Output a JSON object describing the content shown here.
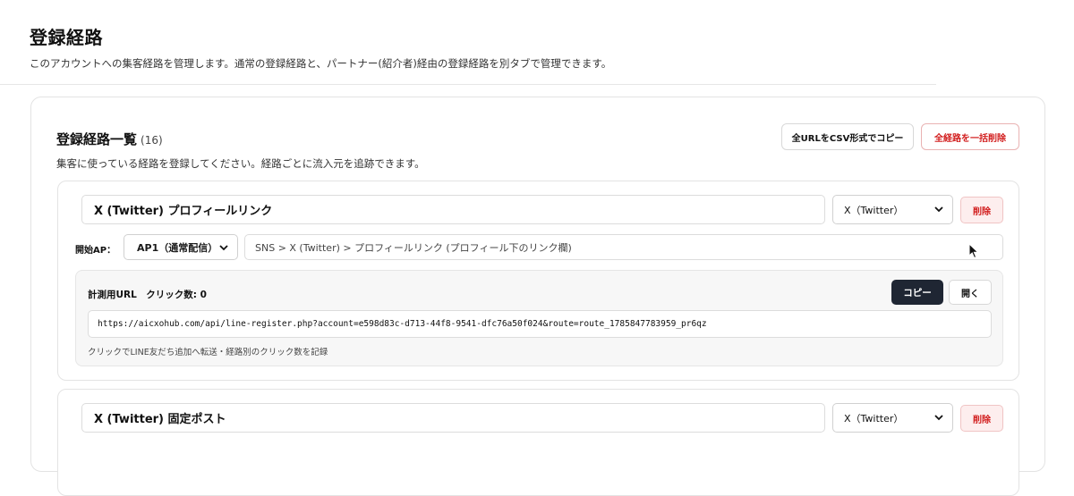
{
  "page": {
    "title": "登録経路",
    "description": "このアカウントへの集客経路を管理します。通常の登録経路と、パートナー(紹介者)経由の登録経路を別タブで管理できます。"
  },
  "section": {
    "title": "登録経路一覧",
    "count": "(16)",
    "description": "集客に使っている経路を登録してください。経路ごとに流入元を追跡できます。",
    "copy_all_label": "全URLをCSV形式でコピー",
    "delete_all_label": "全経路を一括削除"
  },
  "routes": [
    {
      "name": "X (Twitter) プロフィールリンク",
      "type": "X（Twitter）",
      "delete_label": "削除",
      "start_label": "開始AP：",
      "start_ap": "AP1（通常配信）",
      "path_placeholder": "SNS > X (Twitter) > プロフィールリンク (プロフィール下のリンク欄)",
      "tracking_label": "計測用URL　クリック数: 0",
      "copy_label": "コピー",
      "open_label": "開く",
      "url": "https://aicxohub.com/api/line-register.php?account=e598d83c-d713-44f8-9541-dfc76a50f024&route=route_1785847783959_pr6qz",
      "note": "クリックでLINE友だち追加へ転送・経路別のクリック数を記録"
    },
    {
      "name": "X (Twitter) 固定ポスト",
      "type": "X（Twitter）",
      "delete_label": "削除"
    }
  ],
  "icons": {
    "select_chevron": "chevron-down-icon",
    "cursor": "mouse-pointer-icon"
  },
  "colors": {
    "danger": "#d21f1f",
    "primary_dark": "#1f2633"
  }
}
